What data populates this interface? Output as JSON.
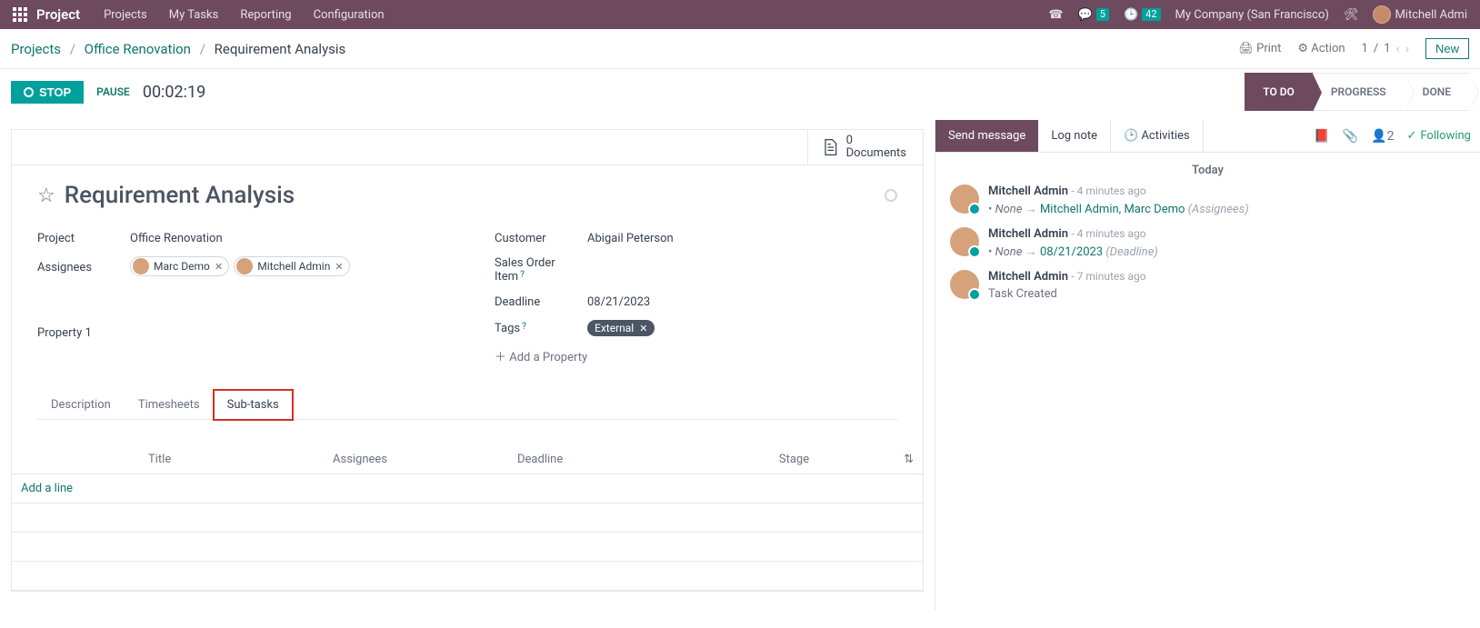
{
  "topbar": {
    "brand": "Project",
    "menu": [
      "Projects",
      "My Tasks",
      "Reporting",
      "Configuration"
    ],
    "chat_badge": "5",
    "clock_badge": "42",
    "company": "My Company (San Francisco)",
    "user": "Mitchell Admi"
  },
  "breadcrumb": {
    "root": "Projects",
    "project": "Office Renovation",
    "task": "Requirement Analysis"
  },
  "toolbar": {
    "print": "Print",
    "action": "Action",
    "page": "1",
    "pages": "1",
    "new_btn": "New"
  },
  "timer": {
    "stop": "STOP",
    "pause": "PAUSE",
    "elapsed": "00:02:19"
  },
  "stages": [
    "TO DO",
    "PROGRESS",
    "DONE"
  ],
  "docs": {
    "count": "0",
    "label": "Documents"
  },
  "title": "Requirement Analysis",
  "fields": {
    "project_lbl": "Project",
    "project_val": "Office Renovation",
    "assignees_lbl": "Assignees",
    "assignees": [
      "Marc Demo",
      "Mitchell Admin"
    ],
    "customer_lbl": "Customer",
    "customer_val": "Abigail Peterson",
    "soi_lbl": "Sales Order Item",
    "deadline_lbl": "Deadline",
    "deadline_val": "08/21/2023",
    "tags_lbl": "Tags",
    "tag": "External",
    "prop_lbl": "Property 1",
    "add_prop": "Add a Property"
  },
  "tabs": [
    "Description",
    "Timesheets",
    "Sub-tasks"
  ],
  "grid": {
    "title": "Title",
    "assignees": "Assignees",
    "deadline": "Deadline",
    "stage": "Stage",
    "add": "Add a line"
  },
  "chatter": {
    "send": "Send message",
    "log": "Log note",
    "activities": "Activities",
    "follow_count": "2",
    "following": "Following",
    "today": "Today",
    "msgs": [
      {
        "name": "Mitchell Admin",
        "time": "4 minutes ago",
        "old": "None",
        "new": "Mitchell Admin, Marc Demo",
        "field": "(Assignees)"
      },
      {
        "name": "Mitchell Admin",
        "time": "4 minutes ago",
        "old": "None",
        "new": "08/21/2023",
        "field": "(Deadline)"
      },
      {
        "name": "Mitchell Admin",
        "time": "7 minutes ago",
        "text": "Task Created"
      }
    ]
  }
}
